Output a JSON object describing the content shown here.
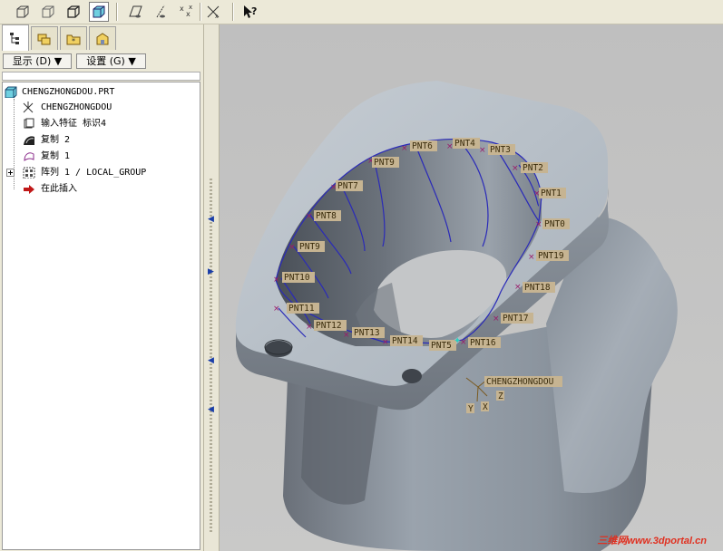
{
  "panel": {
    "menu_show_label": "显示 (D) ▼",
    "menu_settings_label": "设置 (G) ▼"
  },
  "tree": {
    "items": [
      {
        "label": "CHENGZHONGDOU.PRT"
      },
      {
        "label": "CHENGZHONGDOU"
      },
      {
        "label": "输入特征 标识4"
      },
      {
        "label": "复制 2"
      },
      {
        "label": "复制 1"
      },
      {
        "label": "阵列 1 / LOCAL_GROUP"
      },
      {
        "label": "在此插入"
      }
    ]
  },
  "viewport": {
    "points": [
      "PNT0",
      "PNT1",
      "PNT2",
      "PNT3",
      "PNT4",
      "PNT5",
      "PNT6",
      "PNT7",
      "PNT8",
      "PNT9",
      "PNT10",
      "PNT11",
      "PNT12",
      "PNT13",
      "PNT14",
      "PNT15",
      "PNT16",
      "PNT17",
      "PNT18",
      "PNT19"
    ],
    "csys_label": "CHENGZHONGDOU",
    "axis_x": "X",
    "axis_y": "Y",
    "axis_z": "Z"
  },
  "watermark": "三维网www.3dportal.cn",
  "colors": {
    "toolbar_bg": "#ece9d8",
    "model_face": "#a9b3bd",
    "model_dark": "#5a6068",
    "curve": "#2a2ab8",
    "point_marker": "#9a1a6a"
  }
}
